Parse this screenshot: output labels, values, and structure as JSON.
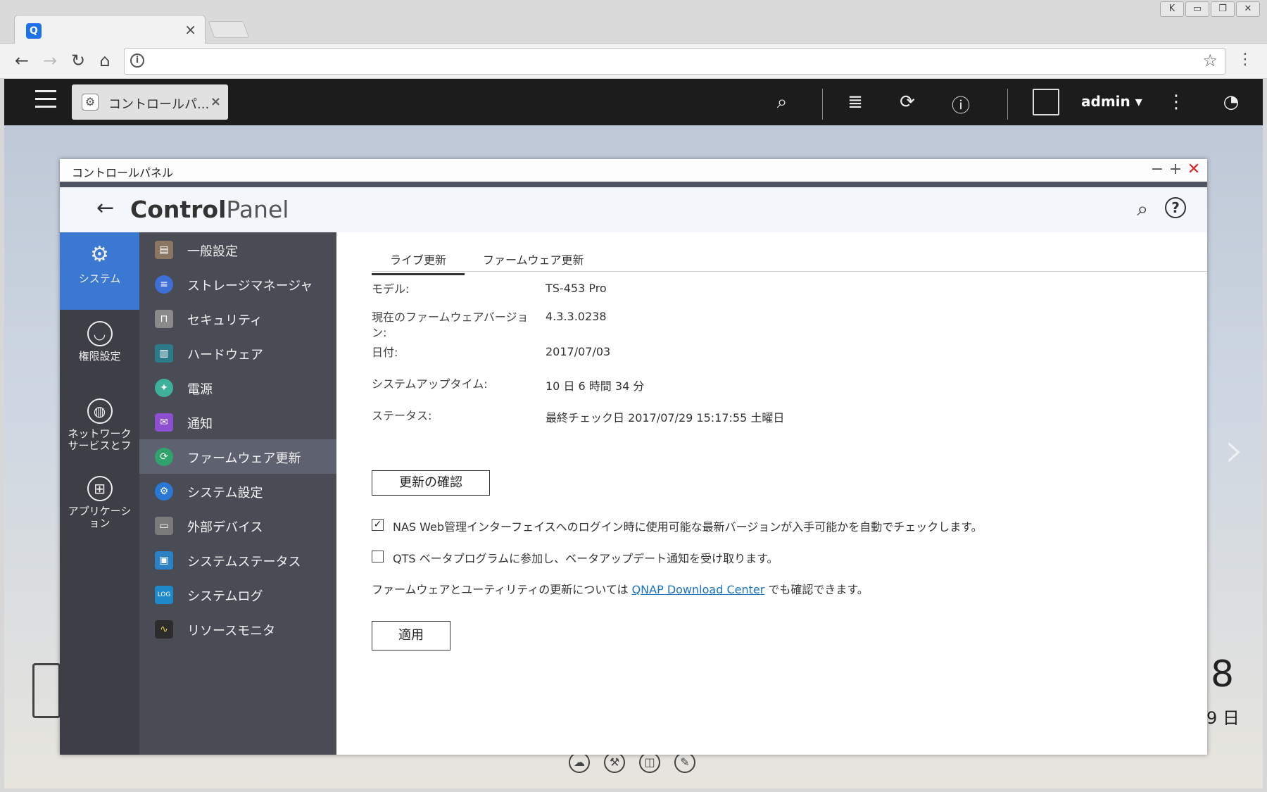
{
  "browser": {
    "tab_close": "×",
    "omni_info": "i",
    "star": "☆",
    "menu": "⋮",
    "window_buttons": [
      "K",
      "▭",
      "❐",
      "✕"
    ]
  },
  "qts": {
    "tab_label": "コントロールパ...",
    "tab_close": "×",
    "user": "admin ▾"
  },
  "window": {
    "title": "コントロールパネル"
  },
  "header": {
    "title_bold": "Control",
    "title_light": "Panel"
  },
  "categories": [
    {
      "label": "システム"
    },
    {
      "label": "権限設定"
    },
    {
      "label": "ネットワーク\nサービスとフ"
    },
    {
      "label": "アプリケーシ\nョン"
    }
  ],
  "submenu": [
    {
      "label": "一般設定",
      "color": "#7a6a5a"
    },
    {
      "label": "ストレージマネージャ",
      "color": "#3d6fd4"
    },
    {
      "label": "セキュリティ",
      "color": "#8a8a8a"
    },
    {
      "label": "ハードウェア",
      "color": "#2d7b8a"
    },
    {
      "label": "電源",
      "color": "#3fb19b"
    },
    {
      "label": "通知",
      "color": "#8b4fcf"
    },
    {
      "label": "ファームウェア更新",
      "color": "#2fa36b"
    },
    {
      "label": "システム設定",
      "color": "#2a78d6"
    },
    {
      "label": "外部デバイス",
      "color": "#7a7a7a"
    },
    {
      "label": "システムステータス",
      "color": "#2b80c6"
    },
    {
      "label": "システムログ",
      "color": "#1e88c8"
    },
    {
      "label": "リソースモニタ",
      "color": "#2c2c2c"
    }
  ],
  "tabs": [
    "ライブ更新",
    "ファームウェア更新"
  ],
  "info": {
    "model_label": "モデル:",
    "model_value": "TS-453 Pro",
    "fw_label": "現在のファームウェアバージョン:",
    "fw_value": "4.3.3.0238",
    "date_label": "日付:",
    "date_value": "2017/07/03",
    "uptime_label": "システムアップタイム:",
    "uptime_value": "10 日 6 時間 34 分",
    "status_label": "ステータス:",
    "status_value": "最終チェック日 2017/07/29 15:17:55 土曜日"
  },
  "buttons": {
    "check_update": "更新の確認",
    "apply": "適用"
  },
  "options": {
    "auto_check_label": "NAS Web管理インターフェイスへのログイン時に使用可能な最新バージョンが入手可能かを自動でチェックします。",
    "auto_check_checked": true,
    "beta_label": "QTS ベータプログラムに参加し、ベータアップデート通知を受け取ります。",
    "beta_checked": false
  },
  "note": {
    "before": "ファームウェアとユーティリティの更新については ",
    "link": "QNAP Download Center",
    "after": " でも確認できます。"
  },
  "desktop": {
    "clock_big": "8",
    "clock_small": "9 日"
  }
}
